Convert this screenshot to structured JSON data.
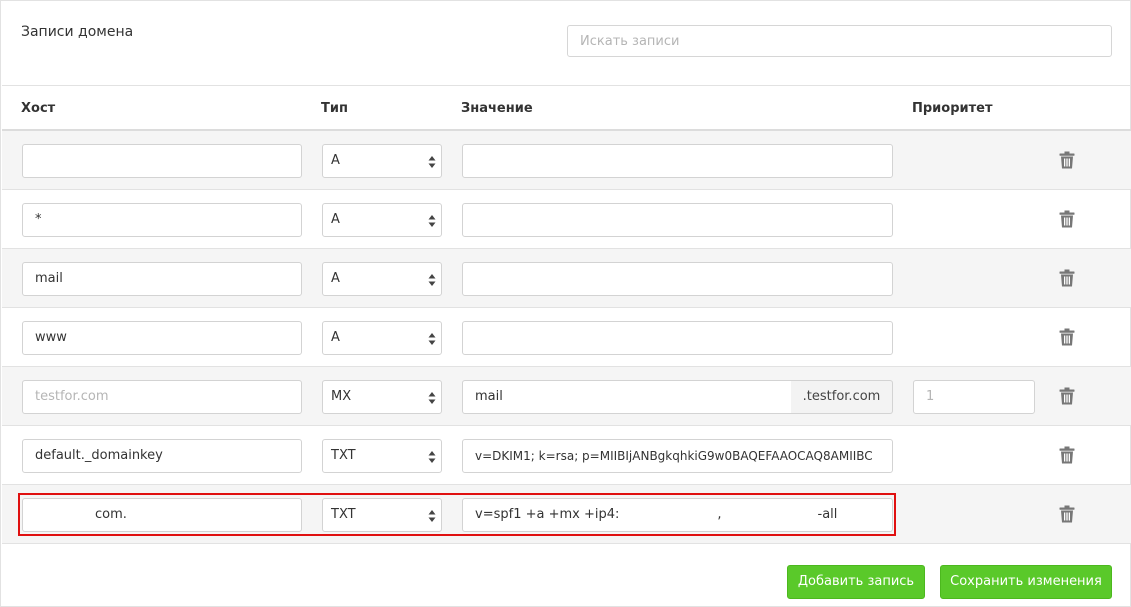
{
  "header": {
    "title": "Записи домена",
    "search_placeholder": "Искать записи"
  },
  "columns": {
    "host": "Хост",
    "type": "Тип",
    "value": "Значение",
    "priority": "Приоритет"
  },
  "records": [
    {
      "host": "",
      "type": "A",
      "value": ""
    },
    {
      "host": "*",
      "type": "A",
      "value": ""
    },
    {
      "host": "mail",
      "type": "A",
      "value": ""
    },
    {
      "host": "www",
      "type": "A",
      "value": ""
    },
    {
      "host_placeholder": "testfor.com",
      "type": "MX",
      "value": "mail",
      "suffix": ".testfor.com",
      "priority_placeholder": "1"
    },
    {
      "host": "default._domainkey",
      "type": "TXT",
      "value": "v=DKIM1; k=rsa; p=MIIBIjANBgkqhkiG9w0BAQEFAAOCAQ8AMIIBC"
    },
    {
      "host": "com.",
      "type": "TXT",
      "value": "v=spf1 +a +mx +ip4:",
      "value_tail": ",",
      "value_end": "-all"
    }
  ],
  "buttons": {
    "add": "Добавить запись",
    "save": "Сохранить изменения"
  },
  "colors": {
    "primary_button": "#5ac92a",
    "highlight": "#e01010"
  }
}
